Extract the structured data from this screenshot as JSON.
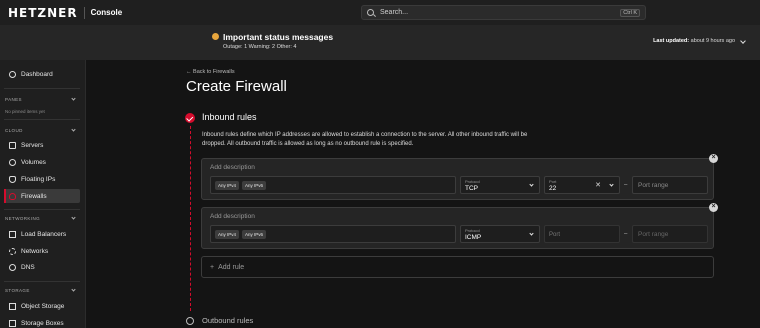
{
  "header": {
    "logo": "HETZNER",
    "console": "Console",
    "search_placeholder": "Search...",
    "search_shortcut": "Ctrl K"
  },
  "status": {
    "title": "Important status messages",
    "counts": "Outage: 1    Warning: 2    Other: 4",
    "last_updated_label": "Last updated:",
    "last_updated_value": "about 9 hours ago"
  },
  "sidebar": {
    "dashboard": "Dashboard",
    "panes_section": "PANES",
    "panes_note": "No pinned items yet",
    "cloud_section": "CLOUD",
    "servers": "Servers",
    "volumes": "Volumes",
    "floating_ips": "Floating IPs",
    "firewalls": "Firewalls",
    "networking_section": "NETWORKING",
    "load_balancers": "Load Balancers",
    "networks": "Networks",
    "dns": "DNS",
    "storage_section": "STORAGE",
    "object_storage": "Object Storage",
    "storage_boxes": "Storage Boxes"
  },
  "main": {
    "back_link": "← Back to Firewalls",
    "title": "Create Firewall",
    "inbound_title": "Inbound rules",
    "inbound_description": "Inbound rules define which IP addresses are allowed to establish a connection to the server. All other inbound traffic will be dropped. All outbound traffic is allowed as long as no outbound rule is specified.",
    "rules": [
      {
        "description_placeholder": "Add description",
        "ip_chip_1": "Any IPv4",
        "ip_chip_2": "Any IPv6",
        "protocol_label": "Protocol",
        "protocol_value": "TCP",
        "port_label": "Port",
        "port_value": "22",
        "range_placeholder": "Port range"
      },
      {
        "description_placeholder": "Add description",
        "ip_chip_1": "Any IPv4",
        "ip_chip_2": "Any IPv6",
        "protocol_label": "Protocol",
        "protocol_value": "ICMP",
        "port_placeholder": "Port",
        "range_placeholder": "Port range"
      }
    ],
    "add_rule": "Add rule",
    "outbound_title": "Outbound rules"
  },
  "colors": {
    "accent": "#d50c2d",
    "status_warning": "#e8a63d",
    "background": "#141414"
  }
}
